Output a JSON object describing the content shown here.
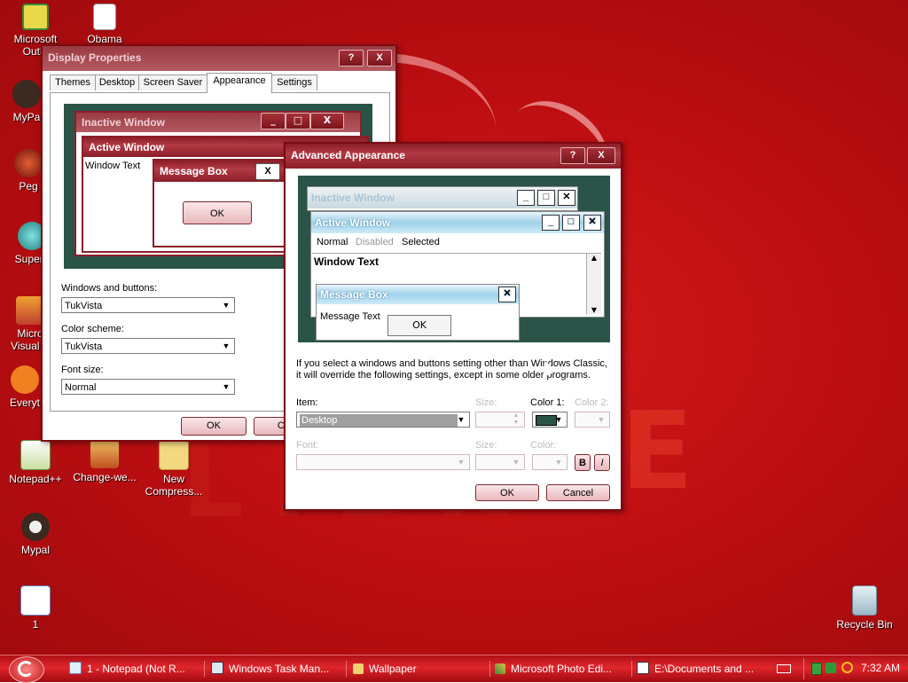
{
  "desktop_icons": [
    {
      "label_lines": [
        "Microsoft",
        "Outlo"
      ],
      "icon": "outlook-icon"
    },
    {
      "label_lines": [
        "Obama"
      ],
      "icon": "image-file-icon"
    },
    {
      "label_lines": [
        "MyPa"
      ],
      "icon": "mypal-icon"
    },
    {
      "label_lines": [
        "Peg"
      ],
      "icon": "peg-icon"
    },
    {
      "label_lines": [
        "Supern"
      ],
      "icon": "supern-icon"
    },
    {
      "label_lines": [
        "Micro",
        "Visual S"
      ],
      "icon": "visual-studio-icon"
    },
    {
      "label_lines": [
        "Everyt"
      ],
      "icon": "everything-icon"
    },
    {
      "label_lines": [
        "Notepad++"
      ],
      "icon": "notepadpp-icon"
    },
    {
      "label_lines": [
        "Change-we..."
      ],
      "icon": "change-we-icon"
    },
    {
      "label_lines": [
        "New",
        "Compress..."
      ],
      "icon": "zip-folder-icon"
    },
    {
      "label_lines": [
        "Mypal"
      ],
      "icon": "mypal-icon"
    },
    {
      "label_lines": [
        "1"
      ],
      "icon": "file-1-icon"
    },
    {
      "label_lines": [
        "Recycle Bin"
      ],
      "icon": "recycle-bin-icon"
    }
  ],
  "display_properties": {
    "title": "Display Properties",
    "help_btn": "?",
    "close_btn": "X",
    "tabs": [
      "Themes",
      "Desktop",
      "Screen Saver",
      "Appearance",
      "Settings"
    ],
    "selected_tab": "Appearance",
    "preview": {
      "inactive_title": "Inactive Window",
      "active_title": "Active Window",
      "window_text": "Window Text",
      "message_box_title": "Message Box",
      "message_ok": "OK"
    },
    "windows_buttons_label": "Windows and buttons:",
    "windows_buttons_value": "TukVista",
    "color_scheme_label": "Color scheme:",
    "color_scheme_value": "TukVista",
    "font_size_label": "Font size:",
    "font_size_value": "Normal",
    "ok": "OK",
    "cancel": "Can"
  },
  "advanced_appearance": {
    "title": "Advanced Appearance",
    "help_btn": "?",
    "close_btn": "X",
    "preview": {
      "inactive_title": "Inactive Window",
      "active_title": "Active Window",
      "menu_items": [
        "Normal",
        "Disabled",
        "Selected"
      ],
      "window_text": "Window Text",
      "message_box_title": "Message Box",
      "message_text": "Message Text",
      "ok": "OK"
    },
    "info_text_line1": "If you select a windows and buttons setting other than Windows Classic,",
    "info_text_line2": "it will override the following settings, except in some older programs.",
    "item_label": "Item:",
    "item_value": "Desktop",
    "size_label": "Size:",
    "color1_label": "Color 1:",
    "color1_value": "#2a5448",
    "color2_label": "Color 2:",
    "font_label": "Font:",
    "font_size_label": "Size:",
    "font_color_label": "Color:",
    "bold_btn": "B",
    "italic_btn": "I",
    "ok": "OK",
    "cancel": "Cancel"
  },
  "taskbar": {
    "tasks": [
      {
        "label": "1 - Notepad (Not R...",
        "icon": "notepad-icon"
      },
      {
        "label": "Windows Task Man...",
        "icon": "task-manager-icon"
      },
      {
        "label": "Wallpaper",
        "icon": "folder-icon"
      },
      {
        "label": "Microsoft Photo Edi...",
        "icon": "photo-editor-icon"
      },
      {
        "label": "E:\\Documents and ...",
        "icon": "zip-app-icon"
      }
    ],
    "clock": "7:32 AM"
  },
  "colors": {
    "desktop_red": "#bf0f12",
    "title_maroon": "#8c1e28",
    "preview_green": "#2a5448",
    "aqua": "#9fd2ea"
  }
}
